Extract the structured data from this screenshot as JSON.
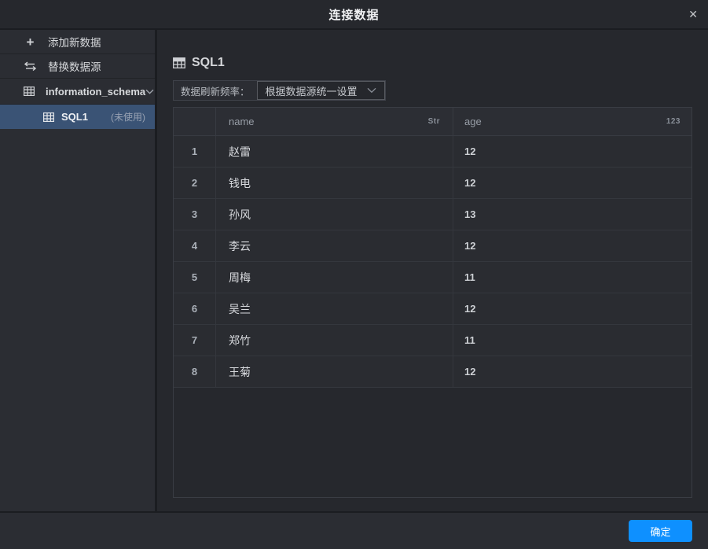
{
  "dialog": {
    "title": "连接数据",
    "close_glyph": "✕"
  },
  "sidebar": {
    "add_new_data": {
      "label": "添加新数据"
    },
    "replace_source": {
      "label": "替换数据源"
    },
    "schema": {
      "label": "information_schema"
    },
    "table_node": {
      "label": "SQL1",
      "badge": "(未使用)"
    }
  },
  "main": {
    "pane_title": "SQL1",
    "refresh": {
      "label": "数据刷新频率：",
      "value": "根据数据源统一设置"
    }
  },
  "table": {
    "columns": [
      {
        "label": "name",
        "type": "Str"
      },
      {
        "label": "age",
        "type": "123"
      }
    ],
    "rows": [
      {
        "index": "1",
        "name": "赵雷",
        "age": "12"
      },
      {
        "index": "2",
        "name": "钱电",
        "age": "12"
      },
      {
        "index": "3",
        "name": "孙风",
        "age": "13"
      },
      {
        "index": "4",
        "name": "李云",
        "age": "12"
      },
      {
        "index": "5",
        "name": "周梅",
        "age": "11"
      },
      {
        "index": "6",
        "name": "吴兰",
        "age": "12"
      },
      {
        "index": "7",
        "name": "郑竹",
        "age": "11"
      },
      {
        "index": "8",
        "name": "王菊",
        "age": "12"
      }
    ]
  },
  "footer": {
    "confirm_label": "确定"
  },
  "colors": {
    "accent": "#0e90ff",
    "selected_item": "#3a5375",
    "sidebar_bg": "#2b2d33",
    "main_bg": "#26282d"
  }
}
